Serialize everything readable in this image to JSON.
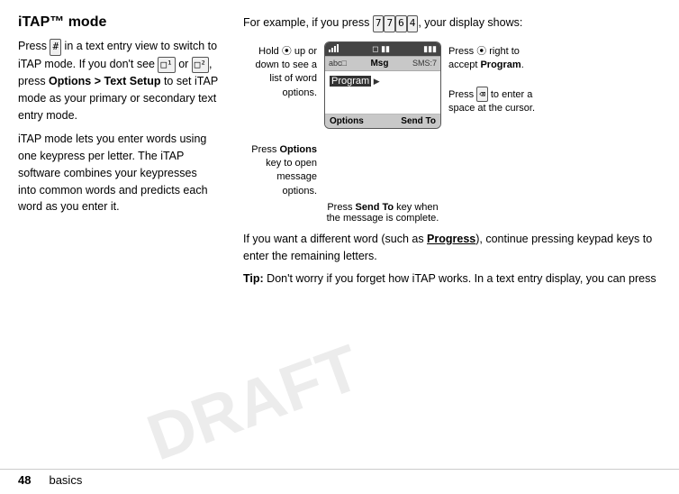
{
  "page": {
    "watermark": "DRAFT"
  },
  "footer": {
    "page_number": "48",
    "section": "basics"
  },
  "left": {
    "title": "iTAP™ mode",
    "paragraph1": "Press # in a text entry view to switch to iTAP mode. If you don't see",
    "paragraph1_or": "or",
    "paragraph1_end": ", press",
    "options_text": "Options > Text Setup",
    "paragraph1_cont": "to set iTAP mode as your primary or secondary text entry mode.",
    "paragraph2": "iTAP mode lets you enter words using one keypress per letter. The iTAP software combines your keypresses into common words and predicts each word as you enter it."
  },
  "right": {
    "intro": "For example, if you press",
    "keys": [
      "7",
      "7",
      "6",
      "4"
    ],
    "intro2": ", your display shows:",
    "diagram": {
      "label_hold": "Hold",
      "label_nav": "up or down to see a list of word options.",
      "label_right": "Press",
      "label_right2": "right to accept",
      "label_right_word": "Program.",
      "label_options": "Press",
      "label_options2": "Options",
      "label_options3": "key to open message options.",
      "label_backspace": "Press",
      "label_backspace2": "to enter a space at the cursor.",
      "label_sendto": "Press",
      "label_sendto2": "Send To",
      "label_sendto3": "key when the message is complete.",
      "phone": {
        "status_left": "ul",
        "status_battery": "|||",
        "mode": "abc□",
        "msg_label": "Msg",
        "sms": "SMS:7",
        "text_line1": "Program",
        "text_cursor": "▶",
        "nav_left": "Options",
        "nav_right": "Send To"
      }
    },
    "bottom1": "If you want a different word (such as",
    "bottom1_word": "Progress",
    "bottom1_end": "), continue pressing keypad keys to enter the remaining letters.",
    "bottom2_tip": "Tip:",
    "bottom2": "Don't worry if you forget how iTAP works. In a text entry display, you can press"
  }
}
